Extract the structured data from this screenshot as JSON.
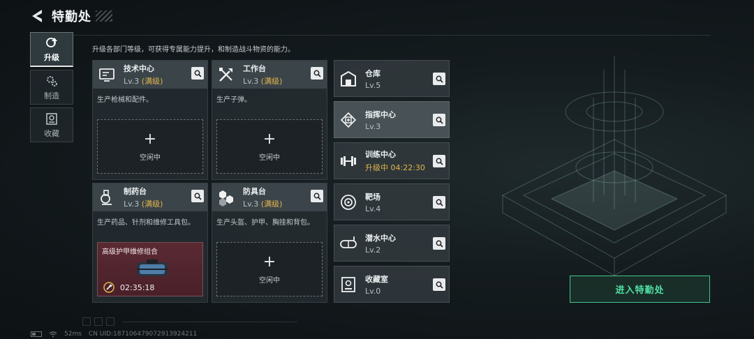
{
  "header": {
    "title": "特勤处"
  },
  "side_tabs": [
    {
      "label": "升级",
      "icon": "upgrade-icon",
      "active": true
    },
    {
      "label": "制造",
      "icon": "gears-icon",
      "active": false
    },
    {
      "label": "收藏",
      "icon": "collection-icon",
      "active": false
    }
  ],
  "description": "升级各部门等级，可获得专属能力提升，和制造战斗物资的能力。",
  "cards": [
    {
      "name": "技术中心",
      "level": "Lv.3",
      "max": "(满级)",
      "text": "生产枪械和配件。",
      "icon": "tech-center-icon",
      "slot": {
        "plus": "+",
        "label": "空闲中"
      }
    },
    {
      "name": "工作台",
      "level": "Lv.3",
      "max": "(满级)",
      "text": "生产子弹。",
      "icon": "workbench-icon",
      "slot": {
        "plus": "+",
        "label": "空闲中"
      }
    },
    {
      "name": "制药台",
      "level": "Lv.3",
      "max": "(满级)",
      "text": "生产药品、针剂和维修工具包。",
      "icon": "pharmacy-icon",
      "craft": {
        "name": "高级护甲维修组合",
        "timer": "02:35:18"
      }
    },
    {
      "name": "防具台",
      "level": "Lv.3",
      "max": "(满级)",
      "text": "生产头盔、护甲、胸挂和背包。",
      "icon": "armor-bench-icon",
      "slot": {
        "plus": "+",
        "label": "空闲中"
      }
    }
  ],
  "rooms": [
    {
      "name": "仓库",
      "level": "Lv.5",
      "icon": "warehouse-icon"
    },
    {
      "name": "指挥中心",
      "level": "Lv.3",
      "icon": "command-center-icon"
    },
    {
      "name": "训练中心",
      "level": "升级中 04:22:30",
      "icon": "dumbbell-icon",
      "upgrading": true
    },
    {
      "name": "靶场",
      "level": "Lv.4",
      "icon": "target-icon"
    },
    {
      "name": "潜水中心",
      "level": "Lv.2",
      "icon": "diving-mask-icon"
    },
    {
      "name": "收藏室",
      "level": "Lv.0",
      "icon": "collection-room-icon"
    }
  ],
  "enter_button": "进入特勤处",
  "status": {
    "ping": "52ms",
    "uid": "CN UID:18710647907291392421​1"
  },
  "colors": {
    "accent_gold": "#e2b54b",
    "accent_green": "#3fc78e",
    "craft_bg": "#5a2a33"
  }
}
